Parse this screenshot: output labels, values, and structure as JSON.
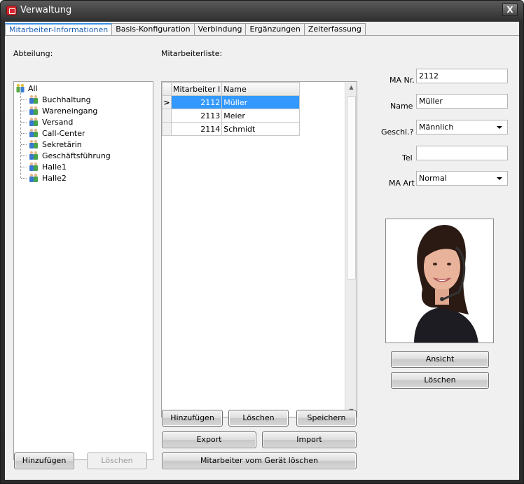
{
  "window": {
    "title": "Verwaltung",
    "close_glyph": "X"
  },
  "tabs": [
    {
      "label": "Mitarbeiter-Informationen"
    },
    {
      "label": "Basis-Konfiguration"
    },
    {
      "label": "Verbindung"
    },
    {
      "label": "Ergänzungen"
    },
    {
      "label": "Zeiterfassung"
    }
  ],
  "department": {
    "label": "Abteilung:",
    "root": "All",
    "items": [
      "Buchhaltung",
      "Wareneingang",
      "Versand",
      "Call-Center",
      "Sekretärin",
      "Geschäftsführung",
      "Halle1",
      "Halle2"
    ],
    "add_label": "Hinzufügen",
    "delete_label": "Löschen"
  },
  "employee_list": {
    "label": "Mitarbeiterliste:",
    "columns": [
      "Mitarbeiter I",
      "Name"
    ],
    "rows": [
      {
        "id": "2112",
        "name": "Müller"
      },
      {
        "id": "2113",
        "name": "Meier"
      },
      {
        "id": "2114",
        "name": "Schmidt"
      }
    ],
    "selected_row_marker": ">",
    "buttons": {
      "add": "Hinzufügen",
      "delete": "Löschen",
      "save": "Speichern",
      "export": "Export",
      "import": "Import",
      "delete_from_device": "Mitarbeiter vom Gerät löschen"
    }
  },
  "details": {
    "ma_nr_label": "MA Nr.",
    "ma_nr_value": "2112",
    "name_label": "Name",
    "name_value": "Müller",
    "gender_label": "Geschl.?",
    "gender_value": "Männlich",
    "tel_label": "Tel",
    "tel_value": "",
    "ma_art_label": "MA Art",
    "ma_art_value": "Normal",
    "view_label": "Ansicht",
    "delete_label": "Löschen"
  },
  "colors": {
    "selection": "#3399ff",
    "accent_tab": "#1c5fb4",
    "titlebar": "#2e2e2e"
  }
}
